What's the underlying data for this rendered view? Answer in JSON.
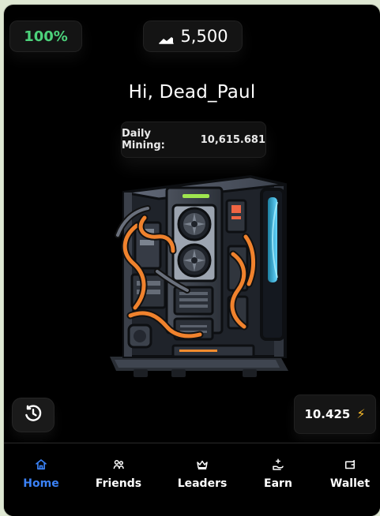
{
  "header": {
    "battery_value": "100%",
    "balance_value": "5,500",
    "balance_icon": "cloud-chart-icon"
  },
  "content": {
    "greeting": "Hi, Dead_Paul",
    "daily_mining_label": "Daily Mining:",
    "daily_mining_value": "10,615.681",
    "pc_image": "mining-pc-image"
  },
  "actions": {
    "history_icon": "history-icon",
    "boost_value": "10.425",
    "boost_icon": "lightning-icon"
  },
  "nav": {
    "items": [
      {
        "label": "Home",
        "icon": "home-icon",
        "active": true
      },
      {
        "label": "Friends",
        "icon": "friends-icon",
        "active": false
      },
      {
        "label": "Leaders",
        "icon": "crown-icon",
        "active": false
      },
      {
        "label": "Earn",
        "icon": "earn-icon",
        "active": false
      },
      {
        "label": "Wallet",
        "icon": "wallet-icon",
        "active": false
      }
    ]
  },
  "colors": {
    "background": "#000000",
    "accent": "#3B82F6",
    "battery": "#4CD27B",
    "lightning": "#FFBF2B"
  }
}
